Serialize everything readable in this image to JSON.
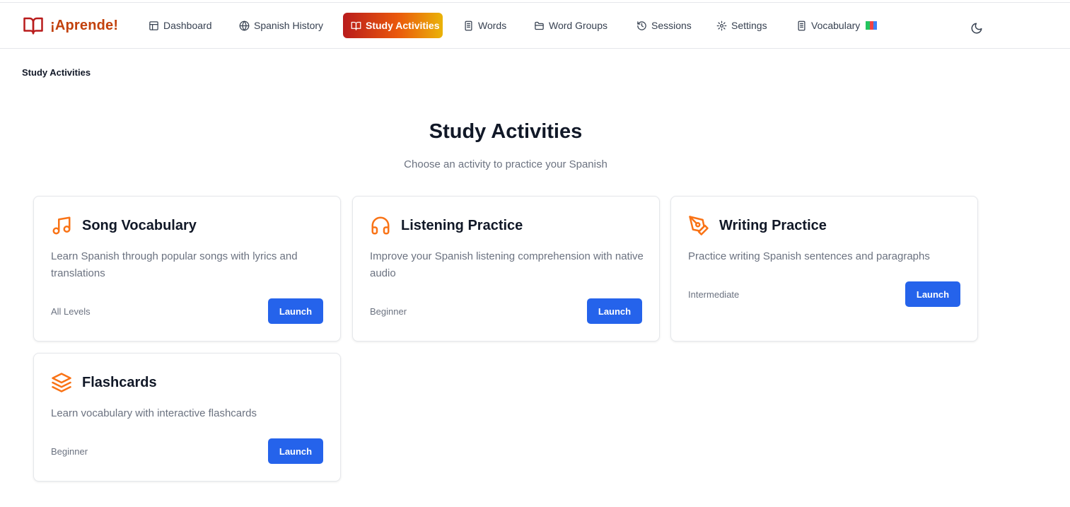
{
  "brand": {
    "name": "¡Aprende!"
  },
  "nav": {
    "items": [
      {
        "label": "Dashboard",
        "icon": "layout-icon"
      },
      {
        "label": "Spanish History",
        "icon": "globe-icon"
      },
      {
        "label": "Study Activities",
        "icon": "book-open-icon",
        "active": true
      },
      {
        "label": "Words",
        "icon": "document-icon"
      },
      {
        "label": "Word Groups",
        "icon": "folder-icon"
      },
      {
        "label": "Sessions",
        "icon": "history-icon"
      },
      {
        "label": "Settings",
        "icon": "gear-icon"
      },
      {
        "label": "Vocabulary",
        "icon": "document-icon"
      }
    ],
    "theme_toggle_icon": "moon-icon"
  },
  "breadcrumb": "Study Activities",
  "page": {
    "title": "Study Activities",
    "subtitle": "Choose an activity to practice your Spanish"
  },
  "activities": [
    {
      "title": "Song Vocabulary",
      "description": "Learn Spanish through popular songs with lyrics and translations",
      "level": "All Levels",
      "button": "Launch",
      "icon": "music-icon"
    },
    {
      "title": "Listening Practice",
      "description": "Improve your Spanish listening comprehension with native audio",
      "level": "Beginner",
      "button": "Launch",
      "icon": "headphones-icon"
    },
    {
      "title": "Writing Practice",
      "description": "Practice writing Spanish sentences and paragraphs",
      "level": "Intermediate",
      "button": "Launch",
      "icon": "pen-tool-icon"
    },
    {
      "title": "Flashcards",
      "description": "Learn vocabulary with interactive flashcards",
      "level": "Beginner",
      "button": "Launch",
      "icon": "layers-icon"
    }
  ],
  "colors": {
    "brand": "#b91c1c",
    "accent_icon": "#f97316",
    "button": "#2563eb",
    "active_gradient": [
      "#b91c1c",
      "#ea580c",
      "#eab308"
    ]
  }
}
